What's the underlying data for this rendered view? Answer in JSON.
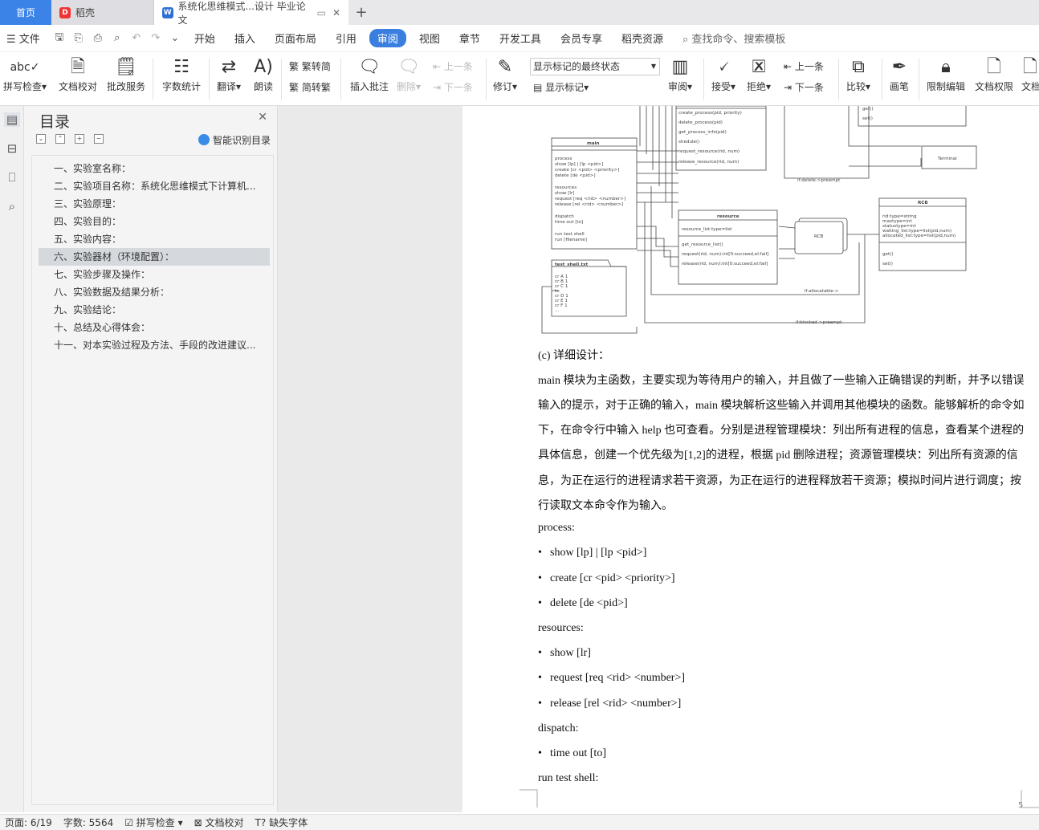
{
  "tabs": {
    "home": "首页",
    "docer": "稻壳",
    "doc": "系统化思维模式...设计 毕业论文"
  },
  "menu": {
    "file": "文件",
    "items": [
      "开始",
      "插入",
      "页面布局",
      "引用",
      "审阅",
      "视图",
      "章节",
      "开发工具",
      "会员专享",
      "稻壳资源"
    ],
    "active": "审阅",
    "search": "查找命令、搜索模板"
  },
  "ribbon": {
    "spell": "拼写检查",
    "proof": "文档校对",
    "review_service": "批改服务",
    "wordcount": "字数统计",
    "translate": "翻译",
    "read": "朗读",
    "to_trad": "繁转简",
    "to_simp": "简转繁",
    "insert_comment": "插入批注",
    "delete": "删除",
    "prev": "上一条",
    "next": "下一条",
    "track": "修订",
    "show_markup": "显示标记",
    "markup_state": "显示标记的最终状态",
    "review": "审阅",
    "accept": "接受",
    "reject": "拒绝",
    "prev2": "上一条",
    "next2": "下一条",
    "compare": "比较",
    "pen": "画笔",
    "restrict": "限制编辑",
    "permission": "文档权限",
    "doc_more": "文档"
  },
  "toc": {
    "title": "目录",
    "smart": "智能识别目录",
    "selected_index": 5,
    "items": [
      "一、实验室名称：",
      "二、实验项目名称：系统化思维模式下计算机...",
      "三、实验原理：",
      "四、实验目的：",
      "五、实验内容：",
      "六、实验器材（环境配置）：",
      "七、实验步骤及操作：",
      "八、实验数据及结果分析：",
      "九、实验结论：",
      "十、总结及心得体会：",
      "十一、对本实验过程及方法、手段的改进建议..."
    ]
  },
  "diagram": {
    "main": {
      "title": "main",
      "lines": [
        "process",
        "show [lp] | [lp <pid>]",
        "create [cr <pid> <priority>]",
        "delete [de <pid>]",
        "resources",
        "show [lr]",
        "request [req <rid> <number>]",
        "release [rel <rid> <number>]",
        "dispatch",
        "time out [to]",
        "run test shell",
        "run [filename]"
      ]
    },
    "process_methods": [
      "create_process(pid, priority)",
      "delete_process(pid)",
      "get_process_info(pid)",
      "shedule()",
      "request_resource(rid, num)",
      "release_resource(rid, num)"
    ],
    "top_right": [
      "get()",
      "set()"
    ],
    "terminal": "Terminal",
    "resource": {
      "title": "resource",
      "attr": "resource_list:type=list",
      "methods": [
        "get_resource_list()",
        "request(rid, num):int[0:succeed,el:fail]",
        "release(rid, num):int[0:succeed,el:fail]"
      ]
    },
    "rcb_small": "RCB",
    "rcb": {
      "title": "RCB",
      "attrs": [
        "rid:type=string",
        "maxtype=int",
        "statustype=int",
        "waiting_list:type=list(pid,num)",
        "allocated_list:type=list(pid,num)"
      ],
      "methods": [
        "get()",
        "set()"
      ]
    },
    "shell": {
      "title": "test_shell.txt",
      "lines": [
        "cr A 1",
        "cr B 1",
        "cr C 1",
        "to",
        "cr D 1",
        "cr E 1",
        "cr F 1",
        "..."
      ]
    },
    "labels": {
      "delete": "if:delete->preempt",
      "allocatable": "if:allocatable->",
      "blocked": "if:blocked->preempt"
    }
  },
  "body": {
    "heading": "(c) 详细设计：",
    "para": [
      "main 模块为主函数，主要实现为等待用户的输入，并且做了一些输入正确错误的判断，并予以错误",
      "输入的提示，对于正确的输入，main 模块解析这些输入并调用其他模块的函数。能够解析的命令如",
      "下，在命令行中输入 help 也可查看。分别是进程管理模块：列出所有进程的信息，查看某个进程的",
      "具体信息，创建一个优先级为[1,2]的进程，根据 pid 删除进程；资源管理模块：列出所有资源的信",
      "息，为正在运行的进程请求若干资源，为正在运行的进程释放若干资源；模拟时间片进行调度；按",
      "行读取文本命令作为输入。"
    ],
    "process_label": "process:",
    "process_items": [
      "show [lp] | [lp <pid>]",
      "create [cr <pid> <priority>]",
      "delete [de <pid>]"
    ],
    "resources_label": "resources:",
    "resources_items": [
      "show [lr]",
      "request [req <rid> <number>]",
      "release [rel <rid> <number>]"
    ],
    "dispatch_label": "dispatch:",
    "dispatch_items": [
      "time out [to]"
    ],
    "run_label": "run test shell:",
    "page_number": "5"
  },
  "status": {
    "page": "页面: 6/19",
    "words": "字数: 5564",
    "spell": "拼写检查",
    "proof": "文档校对",
    "missing_font": "缺失字体"
  }
}
